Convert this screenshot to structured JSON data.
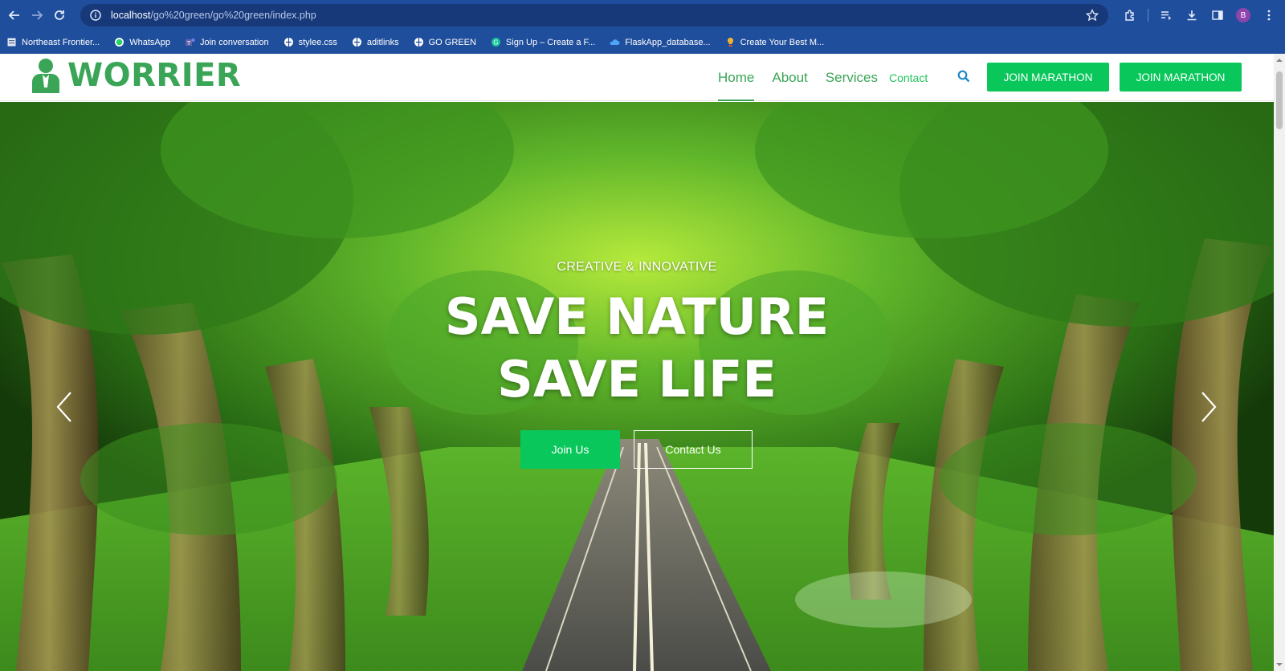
{
  "browser": {
    "url_host": "localhost",
    "url_path": "/go%20green/go%20green/index.php",
    "profile_initial": "B",
    "bookmarks": [
      {
        "label": "Northeast Frontier...",
        "icon": "page-icon"
      },
      {
        "label": "WhatsApp",
        "icon": "whatsapp-icon"
      },
      {
        "label": "Join conversation",
        "icon": "teams-icon"
      },
      {
        "label": "stylee.css",
        "icon": "globe-icon"
      },
      {
        "label": "aditlinks",
        "icon": "globe-icon"
      },
      {
        "label": "GO GREEN",
        "icon": "globe-icon"
      },
      {
        "label": "Sign Up – Create a F...",
        "icon": "grammarly-icon"
      },
      {
        "label": "FlaskApp_database...",
        "icon": "cloud-icon"
      },
      {
        "label": "Create Your Best M...",
        "icon": "bulb-icon"
      }
    ]
  },
  "header": {
    "logo_text": "WORRIER",
    "nav": [
      {
        "label": "Home",
        "active": true
      },
      {
        "label": "About"
      },
      {
        "label": "Services"
      },
      {
        "label": "Contact"
      }
    ],
    "buttons": [
      "JOIN MARATHON",
      "JOIN MARATHON"
    ]
  },
  "hero": {
    "subtitle": "CREATIVE & INNOVATIVE",
    "title_line1": "SAVE NATURE",
    "title_line2": "SAVE LIFE",
    "primary_button": "Join Us",
    "secondary_button": "Contact Us"
  },
  "colors": {
    "brand_green": "#3aa556",
    "button_green": "#09c75a",
    "chrome_blue": "#1f4e9c"
  }
}
